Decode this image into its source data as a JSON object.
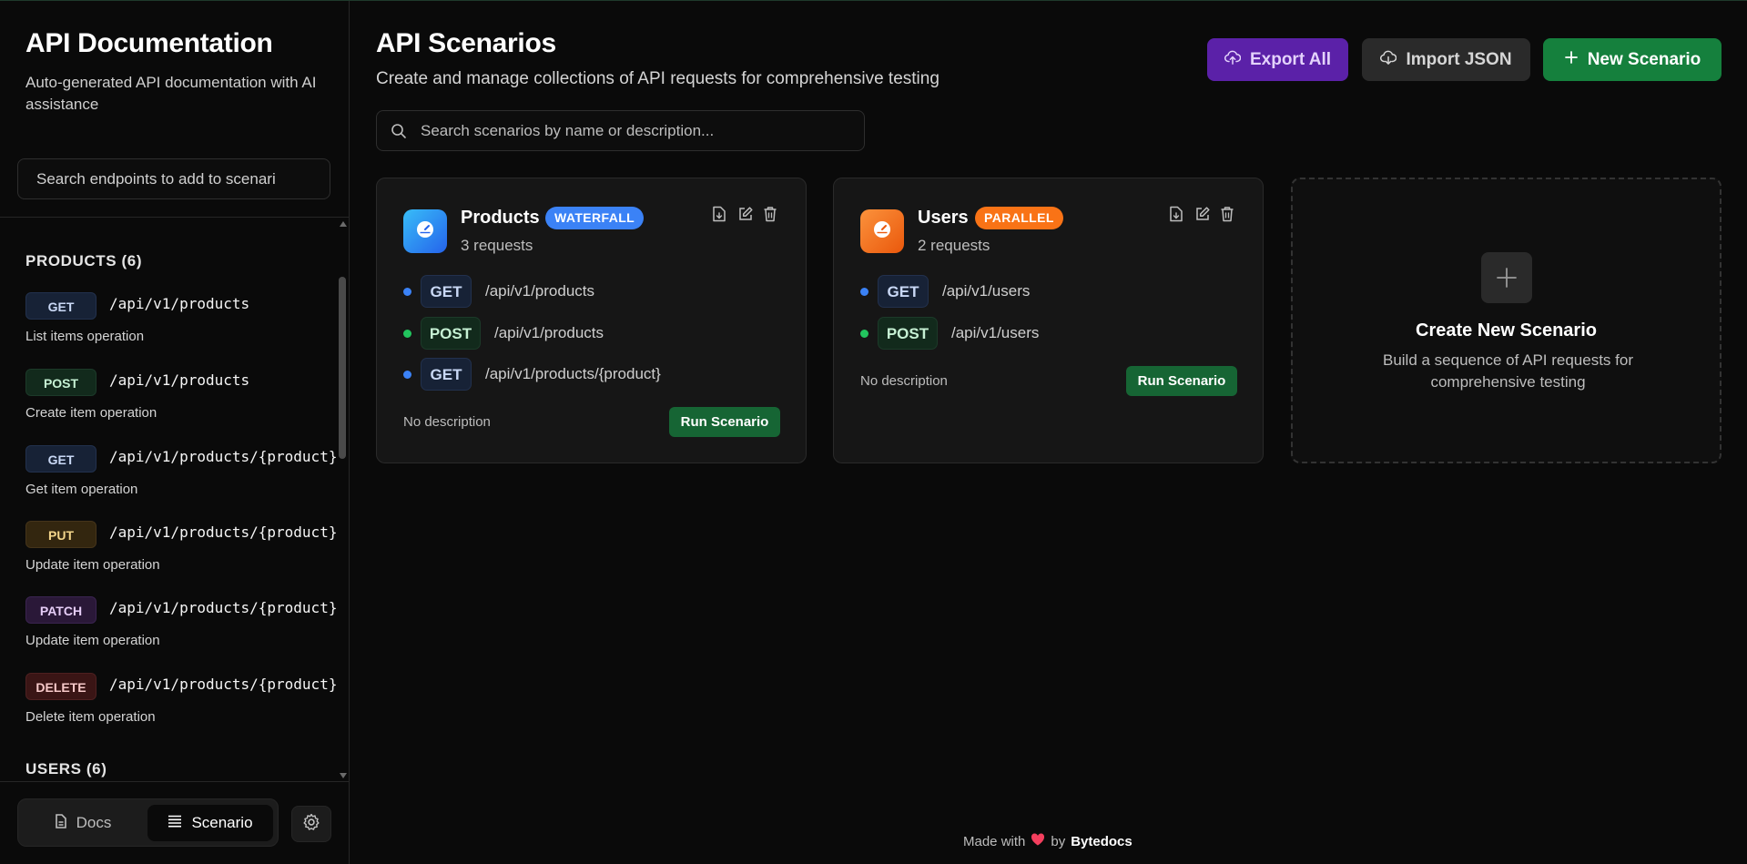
{
  "sidebar": {
    "title": "API Documentation",
    "subtitle": "Auto-generated API documentation with AI assistance",
    "search_text": "Search endpoints to add to scenari",
    "groups": [
      {
        "title": "PRODUCTS (6)",
        "endpoints": [
          {
            "method": "GET",
            "path": "/api/v1/products",
            "desc": "List items operation"
          },
          {
            "method": "POST",
            "path": "/api/v1/products",
            "desc": "Create item operation"
          },
          {
            "method": "GET",
            "path": "/api/v1/products/{product}",
            "desc": "Get item operation"
          },
          {
            "method": "PUT",
            "path": "/api/v1/products/{product}",
            "desc": "Update item operation"
          },
          {
            "method": "PATCH",
            "path": "/api/v1/products/{product}",
            "desc": "Update item operation"
          },
          {
            "method": "DELETE",
            "path": "/api/v1/products/{product}",
            "desc": "Delete item operation"
          }
        ]
      },
      {
        "title": "USERS (6)"
      }
    ],
    "nav": {
      "docs": "Docs",
      "scenario": "Scenario"
    }
  },
  "main": {
    "title": "API Scenarios",
    "subtitle": "Create and manage collections of API requests for comprehensive testing",
    "buttons": {
      "export": "Export All",
      "import": "Import JSON",
      "new": "New Scenario"
    },
    "search_placeholder": "Search scenarios by name or description...",
    "scenarios": [
      {
        "name": "Products",
        "badge": "WATERFALL",
        "count": "3 requests",
        "requests": [
          {
            "method": "GET",
            "path": "/api/v1/products"
          },
          {
            "method": "POST",
            "path": "/api/v1/products"
          },
          {
            "method": "GET",
            "path": "/api/v1/products/{product}"
          }
        ],
        "desc": "No description",
        "run": "Run Scenario"
      },
      {
        "name": "Users",
        "badge": "PARALLEL",
        "count": "2 requests",
        "requests": [
          {
            "method": "GET",
            "path": "/api/v1/users"
          },
          {
            "method": "POST",
            "path": "/api/v1/users"
          }
        ],
        "desc": "No description",
        "run": "Run Scenario"
      }
    ],
    "create": {
      "title": "Create New Scenario",
      "subtitle": "Build a sequence of API requests for comprehensive testing"
    }
  },
  "footer": {
    "made_with": "Made with",
    "by": "by",
    "brand": "Bytedocs"
  },
  "colors": {
    "export": "#5b21a8",
    "new": "#15803d",
    "waterfall": "#3b82f6",
    "parallel": "#f97316",
    "get_dot": "#3b82f6",
    "post_dot": "#22c55e"
  }
}
